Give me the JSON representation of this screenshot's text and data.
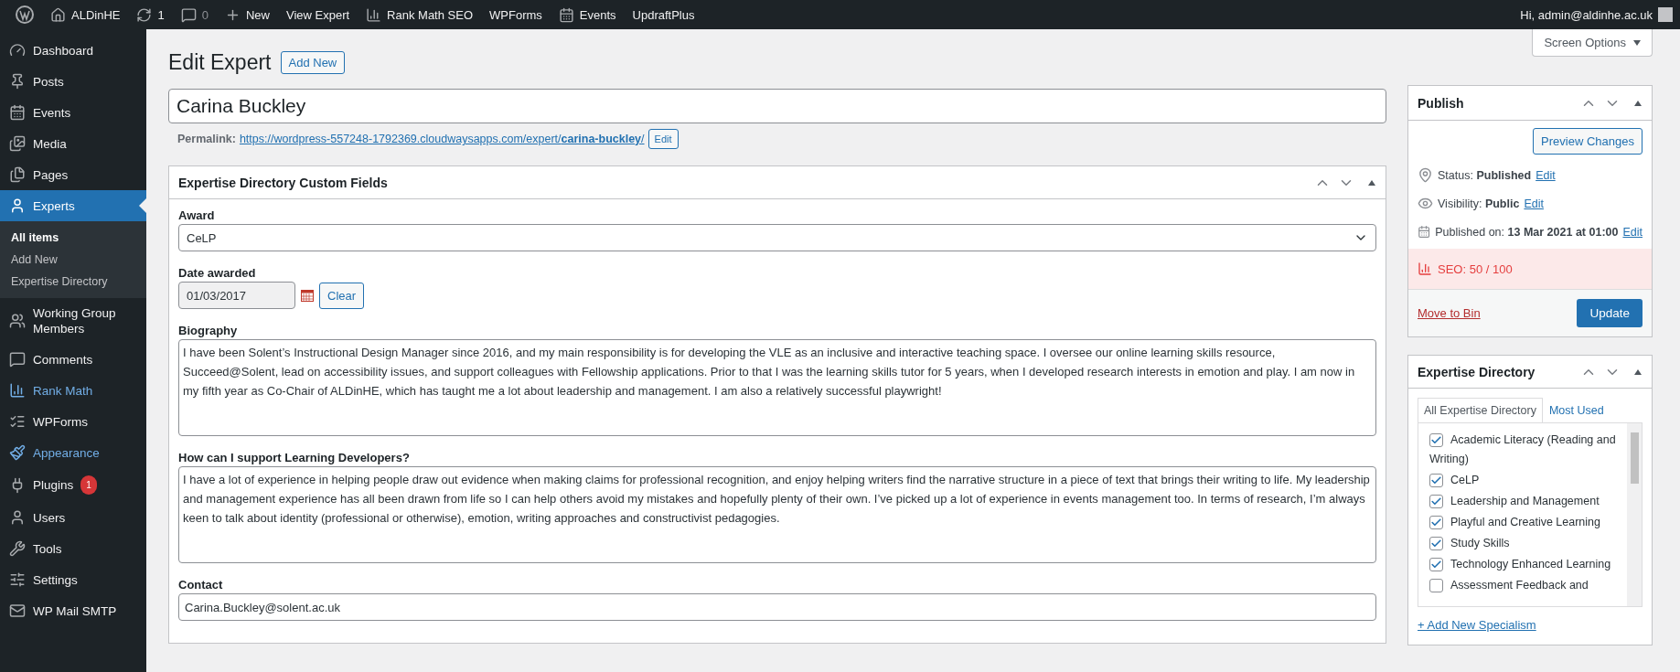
{
  "admin_bar": {
    "items": [
      {
        "kind": "logo"
      },
      {
        "kind": "home",
        "label": "ALDinHE"
      },
      {
        "kind": "updates",
        "label": "1"
      },
      {
        "kind": "comments",
        "label": "0"
      },
      {
        "kind": "new",
        "label": "New"
      },
      {
        "kind": "plain",
        "label": "View Expert"
      },
      {
        "kind": "chart",
        "label": "Rank Math SEO"
      },
      {
        "kind": "plain",
        "label": "WPForms"
      },
      {
        "kind": "calendar",
        "label": "Events"
      },
      {
        "kind": "plain",
        "label": "UpdraftPlus"
      }
    ],
    "greeting": "Hi, admin@aldinhe.ac.uk"
  },
  "sidebar": {
    "items": [
      {
        "label": "Dashboard",
        "selected": false,
        "highlighted": false
      },
      {
        "label": "Posts",
        "selected": false,
        "highlighted": false
      },
      {
        "label": "Events",
        "selected": false,
        "highlighted": false
      },
      {
        "label": "Media",
        "selected": false,
        "highlighted": false
      },
      {
        "label": "Pages",
        "selected": false,
        "highlighted": false
      },
      {
        "label": "Experts",
        "selected": true,
        "highlighted": false,
        "children": [
          {
            "label": "All items",
            "selected": true
          },
          {
            "label": "Add New",
            "selected": false
          },
          {
            "label": "Expertise Directory",
            "selected": false
          }
        ]
      },
      {
        "label": "Working Group Members",
        "selected": false,
        "highlighted": false
      },
      {
        "label": "Comments",
        "selected": false,
        "highlighted": false
      },
      {
        "label": "Rank Math",
        "selected": false,
        "highlighted": true
      },
      {
        "label": "WPForms",
        "selected": false,
        "highlighted": false
      },
      {
        "label": "Appearance",
        "selected": false,
        "highlighted": true
      },
      {
        "label": "Plugins",
        "selected": false,
        "highlighted": false,
        "badge": "1"
      },
      {
        "label": "Users",
        "selected": false,
        "highlighted": false
      },
      {
        "label": "Tools",
        "selected": false,
        "highlighted": false
      },
      {
        "label": "Settings",
        "selected": false,
        "highlighted": false
      },
      {
        "label": "WP Mail SMTP",
        "selected": false,
        "highlighted": false
      }
    ]
  },
  "heading": {
    "title": "Edit Expert",
    "add_new": "Add New"
  },
  "post_title": "Carina Buckley",
  "permalink": {
    "label": "Permalink:",
    "url": "https://wordpress-557248-1792369.cloudwaysapps.com/expert/**carina-buckley**/",
    "edit": "Edit"
  },
  "custom_fields": {
    "title": "Expertise Directory Custom Fields",
    "fields": [
      {
        "kind": "select",
        "label": "Award",
        "value": "CeLP"
      },
      {
        "kind": "date",
        "label": "Date awarded",
        "value": "01/03/2017",
        "button": "Clear"
      },
      {
        "kind": "textarea",
        "label": "Biography",
        "value": "I have been Solent’s Instructional Design Manager since 2016, and my main responsibility is for developing the VLE as an inclusive and interactive teaching space. I oversee our online learning skills resource, Succeed@Solent, lead on accessibility issues, and support colleagues with Fellowship applications. Prior to that I was the learning skills tutor for 5 years, when I developed research interests in emotion and play. I am now in my fifth year as Co-Chair of ALDinHE, which has taught me a lot about leadership and management. I am also a relatively successful playwright!"
      },
      {
        "kind": "textarea",
        "label": "How can I support Learning Developers?",
        "value": "I have a lot of experience in helping people draw out evidence when making claims for professional recognition, and enjoy helping writers find the narrative structure in a piece of text that brings their writing to life. My leadership and management experience has all been drawn from life so I can help others avoid my mistakes and hopefully plenty of their own. I’ve picked up a lot of experience in events management too. In terms of research, I’m always keen to talk about identity (professional or otherwise), emotion, writing approaches and constructivist pedagogies."
      },
      {
        "kind": "text",
        "label": "Contact",
        "value": "Carina.Buckley@solent.ac.uk"
      }
    ]
  },
  "screen_options": "Screen Options",
  "publish": {
    "title": "Publish",
    "preview": "Preview Changes",
    "rows": [
      {
        "kind": "status",
        "label": "Status:",
        "value": "Published",
        "link": "Edit"
      },
      {
        "kind": "visibility",
        "label": "Visibility:",
        "value": "Public",
        "link": "Edit"
      },
      {
        "kind": "date",
        "label": "Published on:",
        "value": "13 Mar 2021 at 01:00",
        "link": "Edit"
      }
    ],
    "seo": "SEO: 50 / 100",
    "move_to_bin": "Move to Bin",
    "update": "Update"
  },
  "directory": {
    "title": "Expertise Directory",
    "tabs": [
      {
        "label": "All Expertise Directory",
        "selected": true
      },
      {
        "label": "Most Used",
        "selected": false
      }
    ],
    "items": [
      {
        "label": "Academic Literacy (Reading and Writing)",
        "checked": true
      },
      {
        "label": "CeLP",
        "checked": true
      },
      {
        "label": "Leadership and Management",
        "checked": true
      },
      {
        "label": "Playful and Creative Learning",
        "checked": true
      },
      {
        "label": "Study Skills",
        "checked": true
      },
      {
        "label": "Technology Enhanced Learning",
        "checked": true
      },
      {
        "label": "Assessment Feedback and",
        "checked": false
      }
    ],
    "add_link": "+ Add New Specialism"
  }
}
